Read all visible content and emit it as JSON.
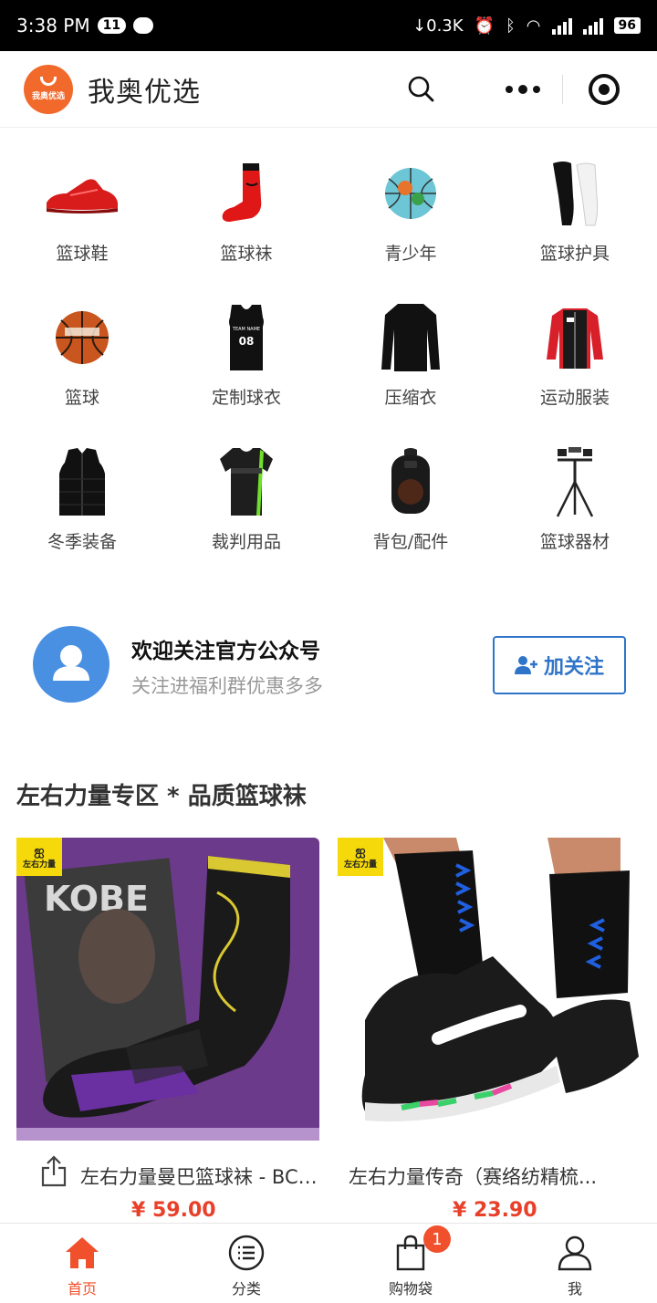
{
  "status_bar": {
    "time": "3:38 PM",
    "notification_count": "11",
    "network_speed": "↓0.3K",
    "battery": "96"
  },
  "header": {
    "logo_text": "我奥优选",
    "title": "我奥优选"
  },
  "categories": [
    {
      "label": "篮球鞋",
      "icon": "red-basketball-shoe"
    },
    {
      "label": "篮球袜",
      "icon": "red-sock"
    },
    {
      "label": "青少年",
      "icon": "youth-basketball"
    },
    {
      "label": "篮球护具",
      "icon": "leg-sleeves"
    },
    {
      "label": "篮球",
      "icon": "basketball"
    },
    {
      "label": "定制球衣",
      "icon": "jersey"
    },
    {
      "label": "压缩衣",
      "icon": "compression-shirt"
    },
    {
      "label": "运动服装",
      "icon": "jacket"
    },
    {
      "label": "冬季装备",
      "icon": "vest"
    },
    {
      "label": "裁判用品",
      "icon": "referee-shirt"
    },
    {
      "label": "背包/配件",
      "icon": "backpack"
    },
    {
      "label": "篮球器材",
      "icon": "tripod"
    }
  ],
  "follow": {
    "title": "欢迎关注官方公众号",
    "subtitle": "关注进福利群优惠多多",
    "button": "加关注"
  },
  "section_title": "左右力量专区 * 品质篮球袜",
  "products": [
    {
      "name": "左右力量曼巴篮球袜 - BCLS...",
      "price": "¥ 59.00",
      "brand_tag": "左右力量"
    },
    {
      "name": "左右力量传奇（赛络纺精梳...",
      "price": "¥ 23.90",
      "brand_tag": "左右力量"
    }
  ],
  "tabbar": [
    {
      "label": "首页",
      "icon": "home-icon"
    },
    {
      "label": "分类",
      "icon": "list-icon"
    },
    {
      "label": "购物袋",
      "icon": "shopping-bag-icon",
      "badge": "1"
    },
    {
      "label": "我",
      "icon": "user-icon"
    }
  ],
  "colors": {
    "accent": "#f0502b",
    "follow_blue": "#2f74c8",
    "price_red": "#e8402a"
  }
}
